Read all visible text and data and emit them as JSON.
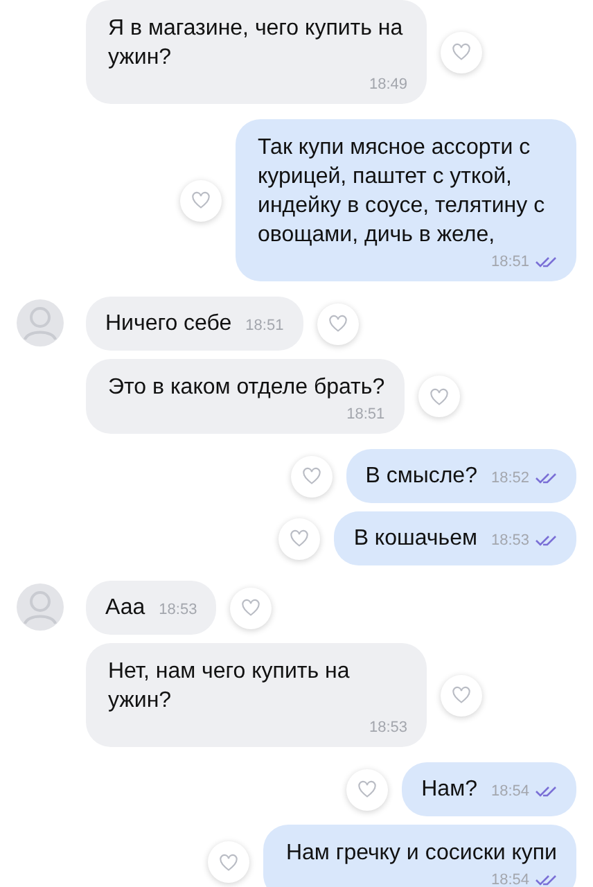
{
  "messages": [
    {
      "kind": "incoming",
      "avatar": false,
      "time_below": true,
      "text": "Я в магазине, чего купить на ужин?",
      "time": "18:49"
    },
    {
      "kind": "outgoing",
      "time_below": true,
      "text": "Так купи мясное ассорти с курицей, паштет с уткой, индейку в соусе, телятину с овощами, дичь в желе,",
      "time": "18:51",
      "read": true
    },
    {
      "kind": "incoming",
      "avatar": true,
      "time_below": false,
      "text": "Ничего себе",
      "time": "18:51"
    },
    {
      "kind": "incoming",
      "avatar": false,
      "time_below": true,
      "text": "Это в каком отделе брать?",
      "time": "18:51"
    },
    {
      "kind": "outgoing",
      "time_below": false,
      "text": "В смысле?",
      "time": "18:52",
      "read": true
    },
    {
      "kind": "outgoing",
      "time_below": false,
      "text": "В кошачьем",
      "time": "18:53",
      "read": true
    },
    {
      "kind": "incoming",
      "avatar": true,
      "time_below": false,
      "text": "Ааа",
      "time": "18:53"
    },
    {
      "kind": "incoming",
      "avatar": false,
      "time_below": true,
      "text": "Нет, нам чего купить на ужин?",
      "time": "18:53"
    },
    {
      "kind": "outgoing",
      "time_below": false,
      "text": "Нам?",
      "time": "18:54",
      "read": true
    },
    {
      "kind": "outgoing",
      "time_below": true,
      "text": "Нам гречку и сосиски купи",
      "time": "18:54",
      "read": true
    }
  ]
}
